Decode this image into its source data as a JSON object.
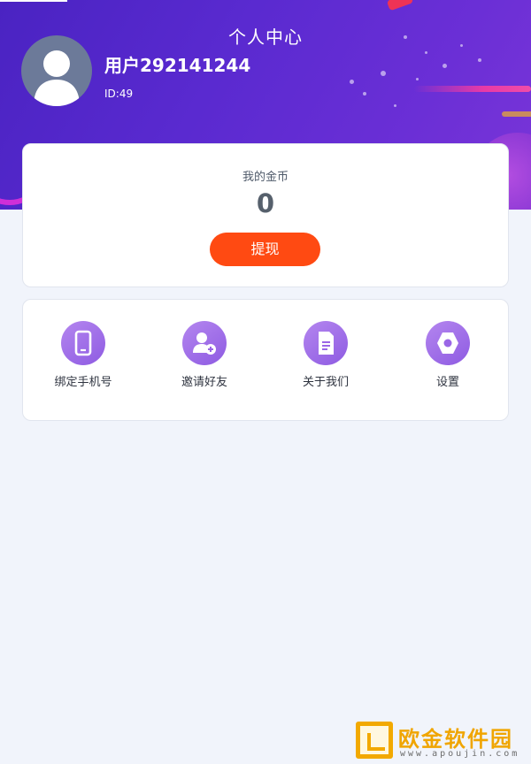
{
  "header": {
    "title": "个人中心",
    "username": "用户292141244",
    "user_id": "ID:49",
    "gradient_start": "#4a23c2",
    "gradient_end": "#7a35d8"
  },
  "coins": {
    "label": "我的金币",
    "value": "0",
    "withdraw_label": "提现",
    "button_color": "#ff4a12"
  },
  "menu": {
    "items": [
      {
        "label": "绑定手机号",
        "icon": "phone-icon"
      },
      {
        "label": "邀请好友",
        "icon": "add-user-icon"
      },
      {
        "label": "关于我们",
        "icon": "document-icon"
      },
      {
        "label": "设置",
        "icon": "hexagon-settings-icon"
      }
    ],
    "icon_color": "#9a66e6"
  },
  "watermark": {
    "title": "欧金软件园",
    "url": "www.apoujin.com"
  }
}
